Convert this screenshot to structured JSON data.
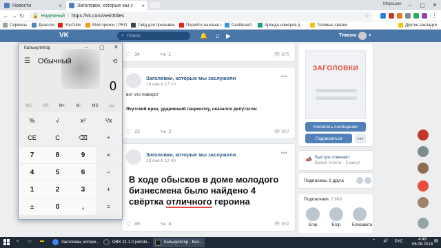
{
  "browser": {
    "tabs": [
      {
        "label": "Новости"
      },
      {
        "label": "Заголовки, которые мы з"
      }
    ],
    "profile_name": "Мирошин",
    "secure_label": "Надежный",
    "url": "https://vk.com/weirdtitles",
    "bookmarks": [
      "Сервисы",
      "Диалоги",
      "YouTube",
      "Мой прокси | PRO",
      "Гайд для призывни",
      "Перейти на канал",
      "Dashboard",
      "Аренда номеров д",
      "Топовые связки",
      "Другие закладки"
    ]
  },
  "vk": {
    "logo": "VK",
    "search_placeholder": "Поиск",
    "user_name": "Тимоха"
  },
  "posts": [
    {
      "likes": "34",
      "reposts": "1",
      "views": "675"
    },
    {
      "group": "Заголовки, которые мы заслужили",
      "time": "18 янв в 17:10",
      "lines": [
        "вот это поворот",
        "Якутский врач, ударивший пациентку, оказался депутатом"
      ],
      "likes": "23",
      "reposts": "2",
      "views": "607"
    },
    {
      "group": "Заголовки, которые мы заслужили",
      "time": "18 янв в 12:40",
      "title_part1": "В ходе обысков в доме молодого бизнесмена было найдено 4 свёртка",
      "title_part2": "отличного",
      "title_part3": " героина",
      "likes": "49",
      "reposts": "4",
      "views": "662"
    }
  ],
  "sidebar": {
    "cover_logo": "ЗАГОЛОВКИ",
    "send_message": "Написать сообщение",
    "subscribe": "Подписаться",
    "more": "•••",
    "fast_reply_title": "Быстро отвечает",
    "fast_reply_sub": "Время ответа – 5 минут",
    "friends_label": "Подписаны 2 друга",
    "subscribers_label": "Подписчики",
    "subscribers_count": "2 968",
    "subscribers": [
      "Егор",
      "Егор",
      "Елизавета"
    ]
  },
  "calculator": {
    "title": "Калькулятор",
    "mode": "Обычный",
    "display": "0",
    "memory": [
      "MC",
      "MR",
      "M+",
      "M-",
      "MS",
      "M▾"
    ],
    "keys": [
      [
        "%",
        "√",
        "x²",
        "¹/x"
      ],
      [
        "CE",
        "C",
        "⌫",
        "÷"
      ],
      [
        "7",
        "8",
        "9",
        "×"
      ],
      [
        "4",
        "5",
        "6",
        "−"
      ],
      [
        "1",
        "2",
        "3",
        "+"
      ],
      [
        "±",
        "0",
        ",",
        "="
      ]
    ]
  },
  "taskbar": {
    "items": [
      "Заголовки, которо...",
      "OBS 21.1.0 (windo...",
      "Калькулятор - Кал..."
    ],
    "lang": "РУС",
    "time": "4:49",
    "date": "06.06.2018"
  },
  "colors": {
    "vk_blue": "#4a76a8",
    "vk_link": "#2a5885",
    "chrome_tabstrip": "#dee1e6"
  }
}
